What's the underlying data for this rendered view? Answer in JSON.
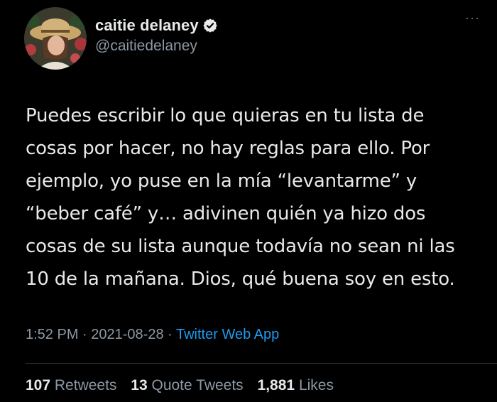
{
  "author": {
    "display_name": "caitie delaney",
    "handle": "@caitiedelaney",
    "verified": true,
    "avatar_icon": "profile-photo"
  },
  "more_menu": {
    "glyph": "···"
  },
  "tweet": {
    "lines": [
      "Puedes escribir lo que quieras en tu lista de",
      "cosas por hacer, no hay reglas para ello. Por",
      "ejemplo, yo puse en la mía “levantarme” y",
      "“beber café” y… adivinen quién ya hizo dos",
      "cosas de su lista aunque todavía no sean ni las",
      "10 de la mañana. Dios, qué buena soy en esto."
    ]
  },
  "meta": {
    "time": "1:52 PM",
    "separator": " · ",
    "date": "2021-08-28",
    "source": "Twitter Web App"
  },
  "stats": {
    "retweets_count": "107",
    "retweets_label": "Retweets",
    "quote_count": "13",
    "quote_label": "Quote Tweets",
    "likes_count": "1,881",
    "likes_label": "Likes"
  },
  "colors": {
    "background": "#000000",
    "text": "#e7e9ea",
    "secondary": "#8b98a5",
    "link": "#1d9bf0",
    "divider": "#2f3336"
  }
}
